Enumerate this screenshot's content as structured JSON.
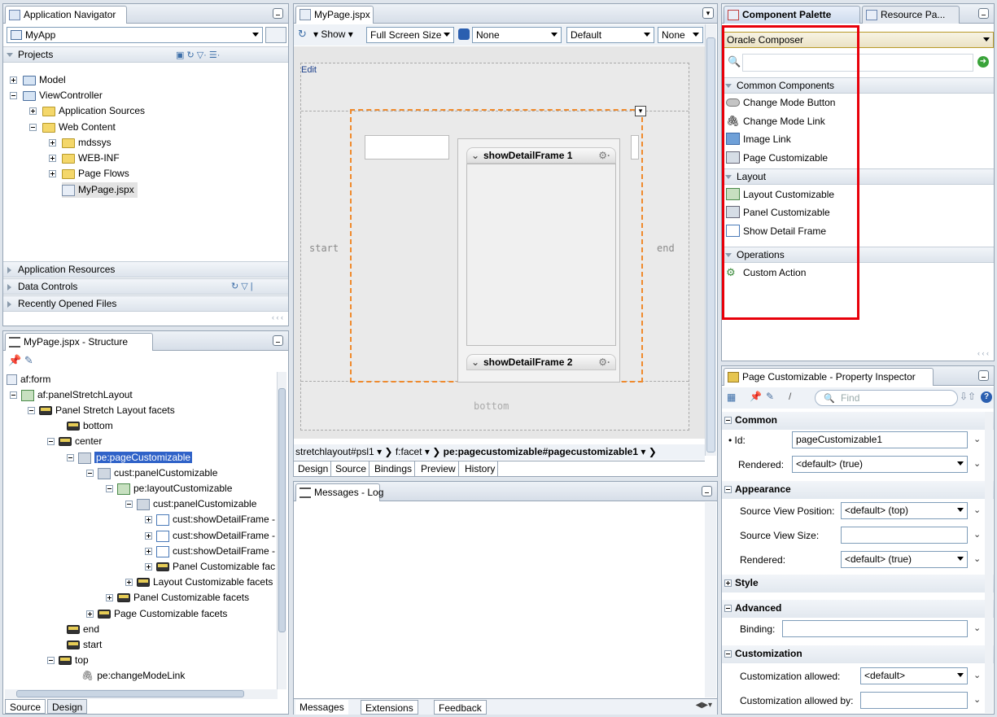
{
  "navigator": {
    "tab_title": "Application Navigator",
    "app_combo": "MyApp",
    "projects_label": "Projects",
    "tree": [
      {
        "label": "Model"
      },
      {
        "label": "ViewController"
      },
      {
        "label": "Application Sources"
      },
      {
        "label": "Web Content"
      },
      {
        "label": "mdssys"
      },
      {
        "label": "WEB-INF"
      },
      {
        "label": "Page Flows"
      },
      {
        "label": "MyPage.jspx"
      }
    ],
    "sections": [
      "Application Resources",
      "Data Controls",
      "Recently Opened Files"
    ]
  },
  "structure": {
    "tab_title": "MyPage.jspx - Structure",
    "tree": [
      {
        "label": "af:form"
      },
      {
        "label": "af:panelStretchLayout"
      },
      {
        "label": "Panel Stretch Layout facets"
      },
      {
        "label": "bottom"
      },
      {
        "label": "center"
      },
      {
        "label": "pe:pageCustomizable"
      },
      {
        "label": "cust:panelCustomizable"
      },
      {
        "label": "pe:layoutCustomizable"
      },
      {
        "label": "cust:panelCustomizable"
      },
      {
        "label": "cust:showDetailFrame -"
      },
      {
        "label": "cust:showDetailFrame -"
      },
      {
        "label": "cust:showDetailFrame -"
      },
      {
        "label": "Panel Customizable fac"
      },
      {
        "label": "Layout Customizable facets"
      },
      {
        "label": "Panel Customizable facets"
      },
      {
        "label": "Page Customizable facets"
      },
      {
        "label": "end"
      },
      {
        "label": "start"
      },
      {
        "label": "top"
      },
      {
        "label": "pe:changeModeLink"
      }
    ],
    "bottom_tabs": [
      "Source",
      "Design"
    ]
  },
  "editor": {
    "tab_title": "MyPage.jspx",
    "show_label": "Show",
    "size_combo": "Full Screen Size",
    "css_combo": "None",
    "skin_combo": "Default",
    "none_combo": "None",
    "edit_label": "Edit",
    "start_label": "start",
    "end_label": "end",
    "bottom_label": "bottom",
    "frame1": "showDetailFrame 1",
    "frame2": "showDetailFrame 2",
    "breadcrumb": [
      "stretchlayout#psl1",
      "f:facet",
      "pe:pagecustomizable#pagecustomizable1"
    ],
    "view_tabs": [
      "Design",
      "Source",
      "Bindings",
      "Preview",
      "History"
    ]
  },
  "log": {
    "tab_title": "Messages - Log",
    "bottom_tabs": [
      "Messages",
      "Extensions",
      "Feedback"
    ]
  },
  "palette": {
    "tab_title": "Component Palette",
    "tab2_title": "Resource Pa...",
    "library_combo": "Oracle Composer",
    "sections": [
      {
        "title": "Common Components",
        "items": [
          "Change Mode Button",
          "Change Mode Link",
          "Image Link",
          "Page Customizable"
        ]
      },
      {
        "title": "Layout",
        "items": [
          "Layout Customizable",
          "Panel Customizable",
          "Show Detail Frame"
        ]
      },
      {
        "title": "Operations",
        "items": [
          "Custom Action"
        ]
      }
    ],
    "highlight_color": "#e8000a"
  },
  "inspector": {
    "tab_title": "Page Customizable - Property Inspector",
    "find_placeholder": "Find",
    "groups": {
      "common": "Common",
      "appearance": "Appearance",
      "style": "Style",
      "advanced": "Advanced",
      "customization": "Customization"
    },
    "fields": {
      "id_label": "Id:",
      "id_value": "pageCustomizable1",
      "rendered_label": "Rendered:",
      "rendered_value": "<default> (true)",
      "svp_label": "Source View Position:",
      "svp_value": "<default> (top)",
      "svs_label": "Source View Size:",
      "rendered2_label": "Rendered:",
      "rendered2_value": "<default> (true)",
      "binding_label": "Binding:",
      "ca_label": "Customization allowed:",
      "ca_value": "<default>",
      "cab_label": "Customization allowed by:"
    }
  }
}
